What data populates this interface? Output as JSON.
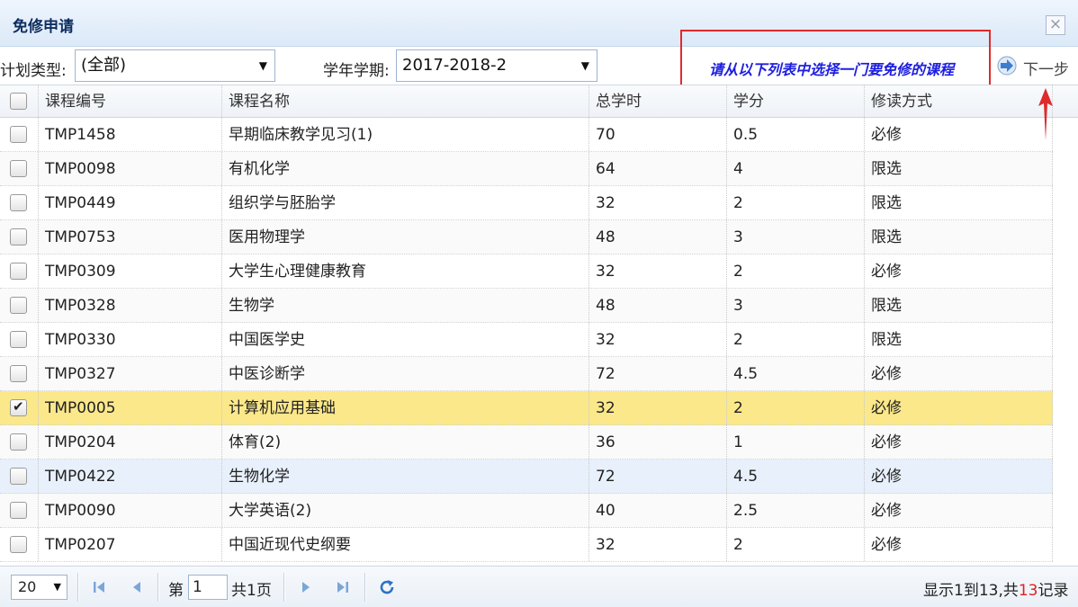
{
  "dialog": {
    "title": "免修申请",
    "close_glyph": "×"
  },
  "toolbar": {
    "plan_type_label": "计划类型:",
    "plan_type_value": "(全部)",
    "term_label": "学年学期:",
    "term_value": "2017-2018-2",
    "hint": "请从以下列表中选择一门要免修的课程",
    "next_label": "下一步"
  },
  "grid": {
    "columns": [
      "课程编号",
      "课程名称",
      "总学时",
      "学分",
      "修读方式"
    ],
    "rows": [
      {
        "code": "TMP1458",
        "name": "早期临床教学见习(1)",
        "hours": "70",
        "credits": "0.5",
        "mode": "必修",
        "checked": false
      },
      {
        "code": "TMP0098",
        "name": "有机化学",
        "hours": "64",
        "credits": "4",
        "mode": "限选",
        "checked": false
      },
      {
        "code": "TMP0449",
        "name": "组织学与胚胎学",
        "hours": "32",
        "credits": "2",
        "mode": "限选",
        "checked": false
      },
      {
        "code": "TMP0753",
        "name": "医用物理学",
        "hours": "48",
        "credits": "3",
        "mode": "限选",
        "checked": false
      },
      {
        "code": "TMP0309",
        "name": "大学生心理健康教育",
        "hours": "32",
        "credits": "2",
        "mode": "必修",
        "checked": false
      },
      {
        "code": "TMP0328",
        "name": "生物学",
        "hours": "48",
        "credits": "3",
        "mode": "限选",
        "checked": false
      },
      {
        "code": "TMP0330",
        "name": "中国医学史",
        "hours": "32",
        "credits": "2",
        "mode": "限选",
        "checked": false
      },
      {
        "code": "TMP0327",
        "name": "中医诊断学",
        "hours": "72",
        "credits": "4.5",
        "mode": "必修",
        "checked": false
      },
      {
        "code": "TMP0005",
        "name": "计算机应用基础",
        "hours": "32",
        "credits": "2",
        "mode": "必修",
        "checked": true
      },
      {
        "code": "TMP0204",
        "name": "体育(2)",
        "hours": "36",
        "credits": "1",
        "mode": "必修",
        "checked": false
      },
      {
        "code": "TMP0422",
        "name": "生物化学",
        "hours": "72",
        "credits": "4.5",
        "mode": "必修",
        "checked": false
      },
      {
        "code": "TMP0090",
        "name": "大学英语(2)",
        "hours": "40",
        "credits": "2.5",
        "mode": "必修",
        "checked": false
      },
      {
        "code": "TMP0207",
        "name": "中国近现代史纲要",
        "hours": "32",
        "credits": "2",
        "mode": "必修",
        "checked": false
      }
    ],
    "selected_row": 8,
    "hover_row": 10
  },
  "pager": {
    "page_size": "20",
    "page_prefix": "第",
    "current_page": "1",
    "page_total": "共1页",
    "info_prefix": "显示1到13,共",
    "info_total": "13",
    "info_suffix": "记录"
  },
  "colors": {
    "accent": "#1d1ee0",
    "highlight_box": "#e02b2b",
    "selected_row": "#fbe88a",
    "hover_row": "#e8f0fb",
    "title_text": "#0e2d5f"
  },
  "icons": {
    "close": "close-icon",
    "next": "arrow-right-icon",
    "first": "first-page-icon",
    "prev": "prev-page-icon",
    "next_page": "next-page-icon",
    "last": "last-page-icon",
    "refresh": "refresh-icon"
  }
}
